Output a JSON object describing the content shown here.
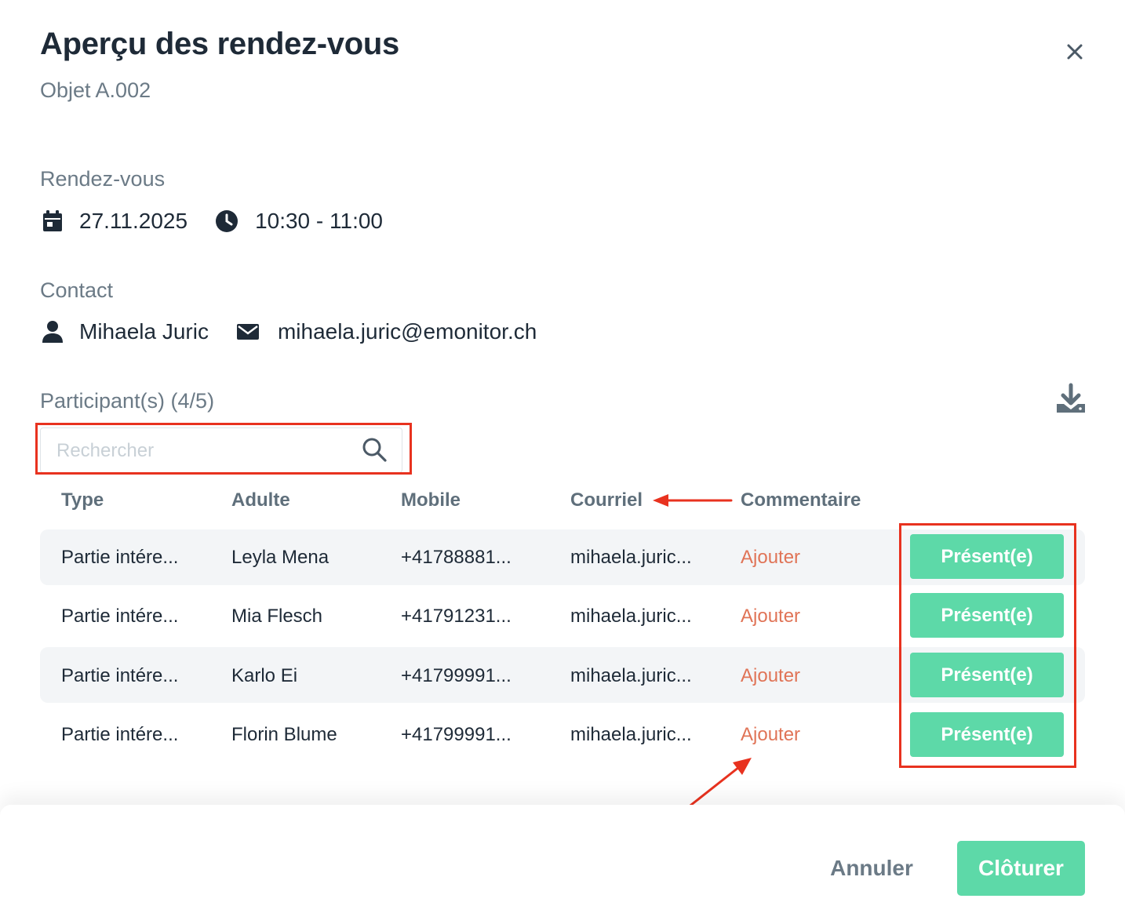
{
  "header": {
    "title": "Aperçu des rendez-vous",
    "subtitle": "Objet A.002",
    "close_icon": "close-icon"
  },
  "appointment": {
    "label": "Rendez-vous",
    "date": "27.11.2025",
    "time": "10:30 - 11:00",
    "date_icon": "calendar-icon",
    "time_icon": "clock-icon"
  },
  "contact": {
    "label": "Contact",
    "name": "Mihaela Juric",
    "email": "mihaela.juric@emonitor.ch",
    "name_icon": "user-icon",
    "email_icon": "envelope-icon"
  },
  "participants": {
    "label": "Participant(s) (4/5)",
    "download_icon": "download-icon",
    "search": {
      "placeholder": "Rechercher",
      "value": "",
      "icon": "search-icon"
    },
    "columns": [
      "Type",
      "Adulte",
      "Mobile",
      "Courriel",
      "Commentaire"
    ],
    "rows": [
      {
        "type": "Partie intére...",
        "adult": "Leyla Mena",
        "mobile": "+41788881...",
        "email": "mihaela.juric...",
        "comment": "Ajouter",
        "status": "Présent(e)"
      },
      {
        "type": "Partie intére...",
        "adult": "Mia Flesch",
        "mobile": "+41791231...",
        "email": "mihaela.juric...",
        "comment": "Ajouter",
        "status": "Présent(e)"
      },
      {
        "type": "Partie intére...",
        "adult": "Karlo Ei",
        "mobile": "+41799991...",
        "email": "mihaela.juric...",
        "comment": "Ajouter",
        "status": "Présent(e)"
      },
      {
        "type": "Partie intére...",
        "adult": "Florin Blume",
        "mobile": "+41799991...",
        "email": "mihaela.juric...",
        "comment": "Ajouter",
        "status": "Présent(e)"
      }
    ]
  },
  "footer": {
    "cancel_label": "Annuler",
    "close_label": "Clôturer"
  },
  "colors": {
    "accent_green": "#5dd9a8",
    "add_link": "#e07457",
    "annotation_red": "#e8321f",
    "title_text": "#1e2a37",
    "muted_text": "#6b7a86"
  }
}
